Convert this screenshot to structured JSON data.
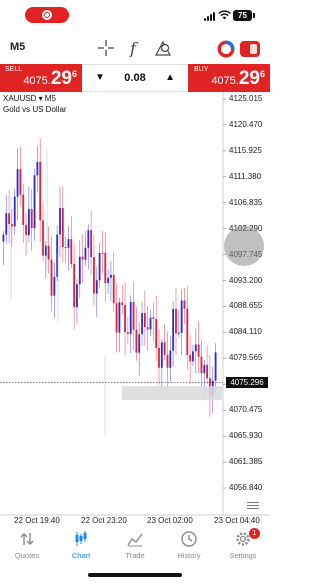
{
  "status_bar": {
    "battery": "75"
  },
  "toolbar": {
    "timeframe": "M5",
    "icons": [
      "crosshair-icon",
      "indicator-icon",
      "objects-icon",
      "account-icon"
    ]
  },
  "trade": {
    "sell_label": "SELL",
    "sell_price_main": "4075.",
    "sell_price_big": "29",
    "sell_price_sup": "6",
    "buy_label": "BUY",
    "buy_price_main": "4075.",
    "buy_price_big": "29",
    "buy_price_sup": "6",
    "lot": "0.08",
    "lot_down": "▼",
    "lot_up": "▲"
  },
  "chart": {
    "symbol": "XAUUSD ▾ M5",
    "description": "Gold vs US Dollar",
    "current_price": "4075.296",
    "price_ticks": [
      "4125.015",
      "4120.470",
      "4115.925",
      "4111.380",
      "4106.835",
      "4102.290",
      "4097.745",
      "4093.200",
      "4088.655",
      "4084.110",
      "4079.565",
      "4075.020",
      "4070.475",
      "4065.930",
      "4061.385",
      "4056.840"
    ],
    "time_ticks": [
      "22 Oct 19:40",
      "22 Oct 23:20",
      "23 Oct 02:00",
      "23 Oct 04:40"
    ],
    "colors": {
      "bull": "#2b2bd6",
      "bear": "#e0203a",
      "accent": "#e02424"
    }
  },
  "chart_data": {
    "type": "candlestick",
    "symbol": "XAUUSD",
    "timeframe": "M5",
    "ylim": [
      4056.8,
      4126.0
    ],
    "price_ticks": [
      4125.015,
      4120.47,
      4115.925,
      4111.38,
      4106.835,
      4102.29,
      4097.745,
      4093.2,
      4088.655,
      4084.11,
      4079.565,
      4075.02,
      4070.475,
      4065.93,
      4061.385,
      4056.84
    ],
    "time_ticks": [
      "22 Oct 19:40",
      "22 Oct 23:20",
      "23 Oct 02:00",
      "23 Oct 04:40"
    ],
    "current_price": 4075.296
  },
  "tabs": [
    {
      "label": "Quotes",
      "icon": "quotes-icon",
      "active": false
    },
    {
      "label": "Chart",
      "icon": "chart-icon",
      "active": true
    },
    {
      "label": "Trade",
      "icon": "trade-icon",
      "active": false
    },
    {
      "label": "History",
      "icon": "history-icon",
      "active": false
    },
    {
      "label": "Settings",
      "icon": "settings-icon",
      "active": false,
      "badge": "1"
    }
  ]
}
